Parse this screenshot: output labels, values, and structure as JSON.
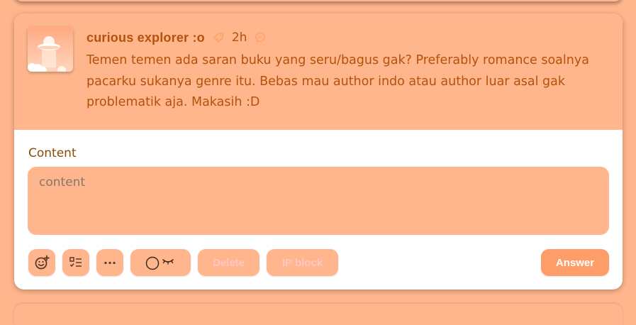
{
  "question": {
    "username": "curious explorer :o",
    "time": "2h",
    "text": "Temen temen ada saran buku yang seru/bagus gak? Preferably romance soalnya pacarku sukanya genre itu. Bebas mau author indo atau author luar asal gak problematik aja. Makasih :D"
  },
  "answer_form": {
    "content_label": "Content",
    "content_placeholder": "content",
    "content_value": ""
  },
  "toolbar": {
    "emoji_icon": "emoji-add-icon",
    "list_icon": "checklist-icon",
    "more_label": "···",
    "visibility_icon": "eye-closed-toggle-icon",
    "delete_label": "Delete",
    "ip_block_label": "IP block",
    "answer_label": "Answer"
  },
  "colors": {
    "background": "#ffb68d",
    "card": "#ffffff",
    "text": "#b4520a",
    "answer_button": "#ff9d68"
  }
}
